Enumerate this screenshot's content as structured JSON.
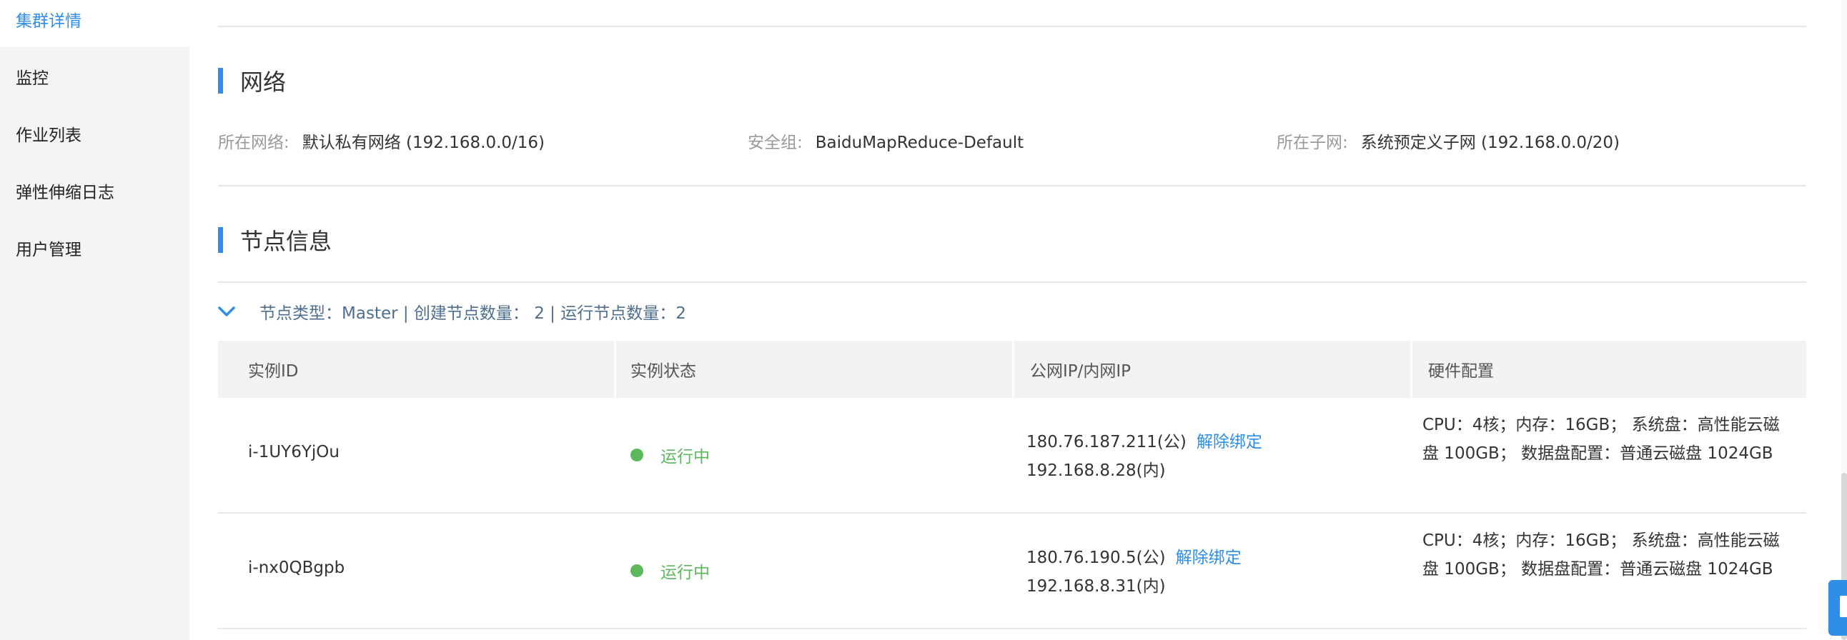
{
  "sidebar": {
    "items": [
      {
        "label": "集群详情",
        "active": true
      },
      {
        "label": "监控"
      },
      {
        "label": "作业列表"
      },
      {
        "label": "弹性伸缩日志"
      },
      {
        "label": "用户管理"
      }
    ]
  },
  "network": {
    "title": "网络",
    "vpc_label": "所在网络:",
    "vpc_value": "默认私有网络 (192.168.0.0/16)",
    "sg_label": "安全组:",
    "sg_value": "BaiduMapReduce-Default",
    "subnet_label": "所在子网:",
    "subnet_value": "系统预定义子网 (192.168.0.0/20)"
  },
  "nodes": {
    "title": "节点信息",
    "group_summary": "节点类型：Master | 创建节点数量： 2 | 运行节点数量：2",
    "columns": [
      "实例ID",
      "实例状态",
      "公网IP/内网IP",
      "硬件配置"
    ],
    "rows": [
      {
        "id": "i-1UY6YjOu",
        "status": "运行中",
        "public_ip": "180.76.187.211(公)",
        "unbind": "解除绑定",
        "private_ip": "192.168.8.28(内)",
        "hardware": "CPU：4核；内存：16GB； 系统盘：高性能云磁盘 100GB； 数据盘配置：普通云磁盘 1024GB"
      },
      {
        "id": "i-nx0QBgpb",
        "status": "运行中",
        "public_ip": "180.76.190.5(公)",
        "unbind": "解除绑定",
        "private_ip": "192.168.8.31(内)",
        "hardware": "CPU：4核；内存：16GB； 系统盘：高性能云磁盘 100GB； 数据盘配置：普通云磁盘 1024GB"
      }
    ]
  },
  "colors": {
    "accent": "#2e8ee8",
    "status_running": "#5cb85c",
    "sidebar_bg": "#f4f4f4",
    "table_header_bg": "#f2f2f2"
  }
}
